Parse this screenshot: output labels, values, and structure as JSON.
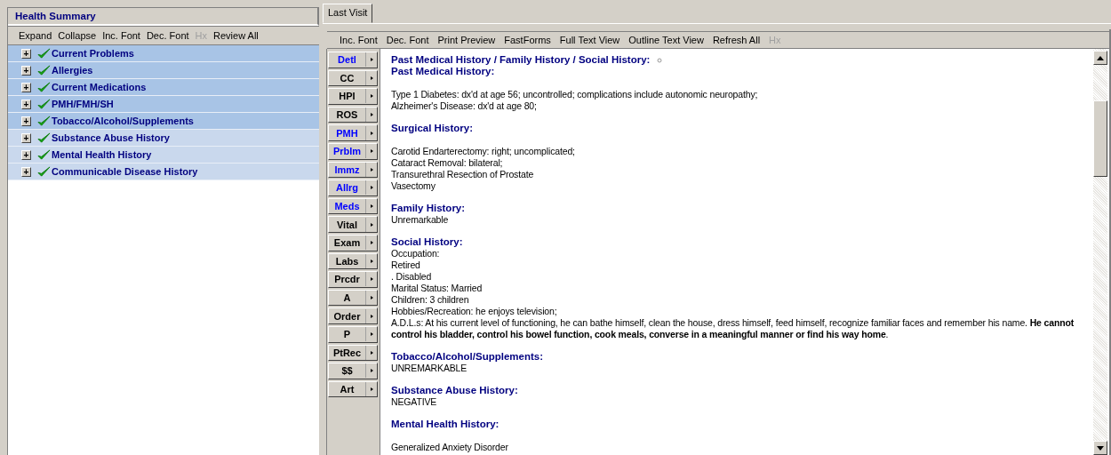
{
  "health_summary": {
    "title": "Health Summary",
    "toolbar": [
      {
        "label": "Expand",
        "disabled": false
      },
      {
        "label": "Collapse",
        "disabled": false
      },
      {
        "label": "Inc. Font",
        "disabled": false
      },
      {
        "label": "Dec. Font",
        "disabled": false
      },
      {
        "label": "Hx",
        "disabled": true
      },
      {
        "label": "Review All",
        "disabled": false
      }
    ],
    "items": [
      {
        "label": "Current Problems",
        "expand": "+",
        "reviewed": true,
        "selected": true
      },
      {
        "label": "Allergies",
        "expand": "+",
        "reviewed": true,
        "selected": true
      },
      {
        "label": "Current Medications",
        "expand": "+",
        "reviewed": true,
        "selected": true
      },
      {
        "label": "PMH/FMH/SH",
        "expand": "+",
        "reviewed": true,
        "selected": true
      },
      {
        "label": "Tobacco/Alcohol/Supplements",
        "expand": "+",
        "reviewed": true,
        "selected": true
      },
      {
        "label": "Substance Abuse History",
        "expand": "+",
        "reviewed": true,
        "selected": false
      },
      {
        "label": "Mental Health History",
        "expand": "+",
        "reviewed": true,
        "selected": false
      },
      {
        "label": "Communicable Disease History",
        "expand": "+",
        "reviewed": true,
        "selected": false
      }
    ]
  },
  "tabs": [
    {
      "label": "Last Visit",
      "selected": true
    }
  ],
  "toolbar": [
    {
      "label": "Inc. Font",
      "disabled": false
    },
    {
      "label": "Dec. Font",
      "disabled": false
    },
    {
      "label": "Print Preview",
      "disabled": false
    },
    {
      "label": "FastForms",
      "disabled": false
    },
    {
      "label": "Full Text View",
      "disabled": false
    },
    {
      "label": "Outline Text View",
      "disabled": false
    },
    {
      "label": "Refresh All",
      "disabled": false
    },
    {
      "label": "Hx",
      "disabled": true
    }
  ],
  "side_buttons": [
    {
      "label": "Detl",
      "has_data": true
    },
    {
      "label": "CC",
      "has_data": false
    },
    {
      "label": "HPI",
      "has_data": false
    },
    {
      "label": "ROS",
      "has_data": false
    },
    {
      "label": "PMH",
      "has_data": true
    },
    {
      "label": "Prblm",
      "has_data": true
    },
    {
      "label": "Immz",
      "has_data": true
    },
    {
      "label": "Allrg",
      "has_data": true
    },
    {
      "label": "Meds",
      "has_data": true
    },
    {
      "label": "Vital",
      "has_data": false
    },
    {
      "label": "Exam",
      "has_data": false
    },
    {
      "label": "Labs",
      "has_data": false
    },
    {
      "label": "Prcdr",
      "has_data": false
    },
    {
      "label": "A",
      "has_data": false
    },
    {
      "label": "Order",
      "has_data": false
    },
    {
      "label": "P",
      "has_data": false
    },
    {
      "label": "PtRec",
      "has_data": false
    },
    {
      "label": "$$",
      "has_data": false
    },
    {
      "label": "Art",
      "has_data": false
    }
  ],
  "content": [
    {
      "kind": "title",
      "text": "Past Medical History / Family History / Social History:"
    },
    {
      "kind": "heading",
      "text": "Past Medical History:",
      "gap_after": true
    },
    {
      "kind": "line",
      "text": "Type 1 Diabetes: dx'd at age 56; uncontrolled; complications include autonomic neuropathy;"
    },
    {
      "kind": "line",
      "text": "Alzheimer's Disease: dx'd at age 80;"
    },
    {
      "kind": "heading",
      "text": "Surgical History:",
      "gap_after": true
    },
    {
      "kind": "line",
      "text": "Carotid Endarterectomy: right; uncomplicated;"
    },
    {
      "kind": "line",
      "text": "Cataract Removal: bilateral;"
    },
    {
      "kind": "line",
      "text": "Transurethral Resection of Prostate"
    },
    {
      "kind": "line",
      "text": "Vasectomy"
    },
    {
      "kind": "heading",
      "text": "Family History:",
      "gap_after": false
    },
    {
      "kind": "line",
      "text": "Unremarkable"
    },
    {
      "kind": "heading",
      "text": "Social History:",
      "gap_after": false
    },
    {
      "kind": "line",
      "text": "Occupation:"
    },
    {
      "kind": "line",
      "text": "Retired"
    },
    {
      "kind": "line",
      "text": ". Disabled"
    },
    {
      "kind": "line",
      "text": "Marital Status: Married"
    },
    {
      "kind": "line",
      "text": "Children: 3 children"
    },
    {
      "kind": "line",
      "text": "Hobbies/Recreation: he enjoys television;"
    },
    {
      "kind": "line",
      "text": "A.D.L.s:  At his current level of functioning, he can bathe himself, clean the house, dress himself, feed himself, recognize familiar faces and remember his name.    **He cannot control his bladder, control his bowel function, cook meals, converse in a meaningful manner or find his way home**."
    },
    {
      "kind": "heading",
      "text": "Tobacco/Alcohol/Supplements:",
      "gap_after": false
    },
    {
      "kind": "line",
      "text": "UNREMARKABLE"
    },
    {
      "kind": "heading",
      "text": "Substance Abuse History:",
      "gap_after": false
    },
    {
      "kind": "line",
      "text": "NEGATIVE"
    },
    {
      "kind": "heading",
      "text": "Mental Health History:",
      "gap_after": true
    },
    {
      "kind": "line",
      "text": "Generalized Anxiety Disorder"
    }
  ]
}
